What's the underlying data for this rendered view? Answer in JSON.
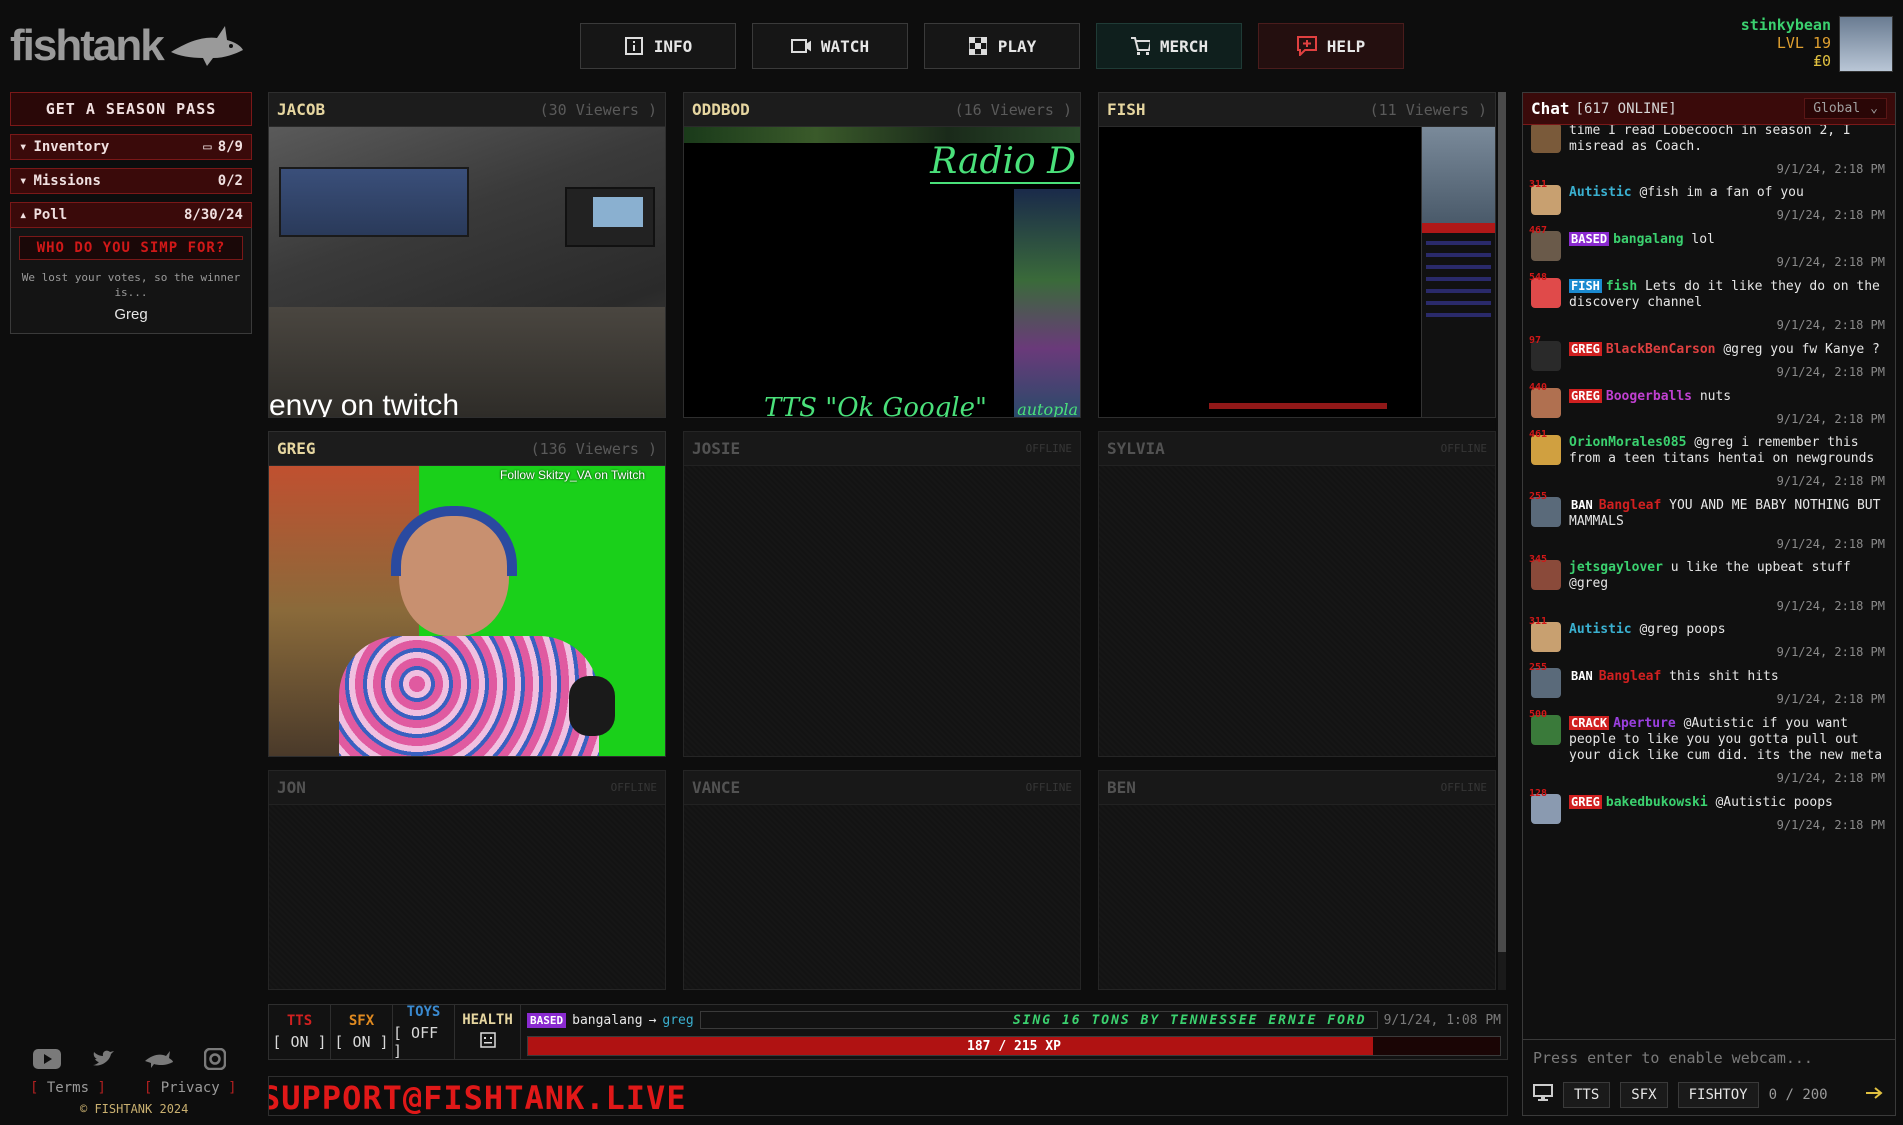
{
  "header": {
    "logo_text": "fishtank",
    "nav": [
      {
        "label": "INFO",
        "icon": "info-icon"
      },
      {
        "label": "WATCH",
        "icon": "video-camera-icon"
      },
      {
        "label": "PLAY",
        "icon": "checkerboard-icon"
      },
      {
        "label": "MERCH",
        "icon": "cart-icon"
      },
      {
        "label": "HELP",
        "icon": "help-chat-icon"
      }
    ],
    "user": {
      "name": "stinkybean",
      "level": "LVL 19",
      "coins": "₤0"
    }
  },
  "left": {
    "season_pass": "GET A SEASON PASS",
    "inventory": {
      "label": "Inventory",
      "value": "8/9"
    },
    "missions": {
      "label": "Missions",
      "value": "0/2"
    },
    "poll": {
      "label": "Poll",
      "date": "8/30/24",
      "question": "WHO DO YOU SIMP FOR?",
      "message": "We lost your votes, so the winner is...",
      "winner": "Greg"
    }
  },
  "cams": [
    {
      "name": "JACOB",
      "viewers": "(30 Viewers )",
      "caption": "envy on twitch"
    },
    {
      "name": "ODDBOD",
      "viewers": "(16 Viewers )",
      "title": "Radio D",
      "tts": "TTS \"Ok Google\"",
      "auto": "autopla"
    },
    {
      "name": "FISH",
      "viewers": "(11 Viewers )"
    },
    {
      "name": "GREG",
      "viewers": "(136 Viewers )",
      "follow": "Follow Skitzy_VA on Twitch"
    },
    {
      "name": "JOSIE",
      "status": "OFFLINE"
    },
    {
      "name": "SYLVIA",
      "status": "OFFLINE"
    },
    {
      "name": "JON",
      "status": "OFFLINE"
    },
    {
      "name": "VANCE",
      "status": "OFFLINE"
    },
    {
      "name": "BEN",
      "status": "OFFLINE"
    }
  ],
  "toggles": [
    {
      "label": "TTS",
      "state": "[ ON ]",
      "color": "#d02020"
    },
    {
      "label": "SFX",
      "state": "[ ON ]",
      "color": "#e08a20"
    },
    {
      "label": "TOYS",
      "state": "[ OFF ]",
      "color": "#3a8ad0"
    }
  ],
  "health_label": "HEALTH",
  "activity": {
    "badge": "BASED",
    "from": "bangalang",
    "arrow": "→",
    "to": "greg",
    "marquee": "SING 16 TONS BY TENNESSEE ERNIE FORD",
    "time": "9/1/24, 1:08 PM"
  },
  "xp": {
    "text": "187 / 215 XP",
    "current": 187,
    "max": 215
  },
  "support_text": "SUPPORT@FISHTANK.LIVE",
  "footer": {
    "terms": "Terms",
    "privacy": "Privacy",
    "copyright": "© FISHTANK 2024",
    "icons": [
      "youtube-icon",
      "twitter-icon",
      "fish-icon",
      "instagram-icon"
    ]
  },
  "chat": {
    "title": "Chat",
    "online": "[617 ONLINE]",
    "scope": "Global",
    "input_placeholder": "Press enter to enable webcam...",
    "buttons": [
      "TTS",
      "SFX",
      "FISHTOY"
    ],
    "count": "0 / 200",
    "messages": [
      {
        "lvl": "",
        "badge": "",
        "badge_color": "",
        "user": "",
        "user_color": "",
        "text": "time I read Lobecooch in season 2, I misread as Coach.",
        "time": "9/1/24, 2:18 PM",
        "av": "#7a5a3a"
      },
      {
        "lvl": "311",
        "badge": "",
        "badge_color": "",
        "user": "Autistic",
        "user_color": "#3ab0d0",
        "text": "@fish im a fan of you",
        "time": "9/1/24, 2:18 PM",
        "av": "#c8a070"
      },
      {
        "lvl": "467",
        "badge": "BASED",
        "badge_color": "#8a2ad0",
        "user": "bangalang",
        "user_color": "#3bd16f",
        "text": "lol",
        "time": "9/1/24, 2:18 PM",
        "av": "#6a5a4a"
      },
      {
        "lvl": "548",
        "badge": "FISH",
        "badge_color": "#1a8ad0",
        "user": "fish",
        "user_color": "#3bd16f",
        "text": "Lets do it like they do on the discovery channel",
        "time": "9/1/24, 2:18 PM",
        "av": "#e04a4a"
      },
      {
        "lvl": "97",
        "badge": "GREG",
        "badge_color": "#d02020",
        "user": "BlackBenCarson",
        "user_color": "#e04040",
        "text": "@greg you fw Kanye ?",
        "time": "9/1/24, 2:18 PM",
        "av": "#2a2a2a"
      },
      {
        "lvl": "440",
        "badge": "GREG",
        "badge_color": "#d02020",
        "user": "Boogerballs",
        "user_color": "#c040d0",
        "text": "nuts",
        "time": "9/1/24, 2:18 PM",
        "av": "#b07050"
      },
      {
        "lvl": "461",
        "badge": "",
        "badge_color": "",
        "user": "OrionMorales085",
        "user_color": "#3bd16f",
        "text": "@greg i remember this from a teen titans hentai on newgrounds",
        "time": "9/1/24, 2:18 PM",
        "av": "#d0a040"
      },
      {
        "lvl": "255",
        "badge": "BAN",
        "badge_color": "",
        "user": "Bangleaf",
        "user_color": "#d02020",
        "text": "YOU AND ME BABY NOTHING BUT MAMMALS",
        "time": "9/1/24, 2:18 PM",
        "av": "#5a6a7a"
      },
      {
        "lvl": "345",
        "badge": "",
        "badge_color": "",
        "user": "jetsgaylover",
        "user_color": "#3bd16f",
        "text": "u like the upbeat stuff @greg",
        "time": "9/1/24, 2:18 PM",
        "av": "#8a4a3a"
      },
      {
        "lvl": "311",
        "badge": "",
        "badge_color": "",
        "user": "Autistic",
        "user_color": "#3ab0d0",
        "text": "@greg poops",
        "time": "9/1/24, 2:18 PM",
        "av": "#c8a070"
      },
      {
        "lvl": "255",
        "badge": "BAN",
        "badge_color": "",
        "user": "Bangleaf",
        "user_color": "#d02020",
        "text": "this shit hits",
        "time": "9/1/24, 2:18 PM",
        "av": "#5a6a7a"
      },
      {
        "lvl": "500",
        "badge": "CRACK",
        "badge_color": "#d02020",
        "user": "Aperture",
        "user_color": "#9a40e0",
        "text": "@Autistic if you want people to like you you gotta pull out your dick like cum did. its the new meta",
        "time": "9/1/24, 2:18 PM",
        "av": "#3a7a3a"
      },
      {
        "lvl": "128",
        "badge": "GREG",
        "badge_color": "#d02020",
        "user": "bakedbukowski",
        "user_color": "#3bd16f",
        "text": "@Autistic poops",
        "time": "9/1/24, 2:18 PM",
        "av": "#8a9ab0"
      }
    ]
  }
}
